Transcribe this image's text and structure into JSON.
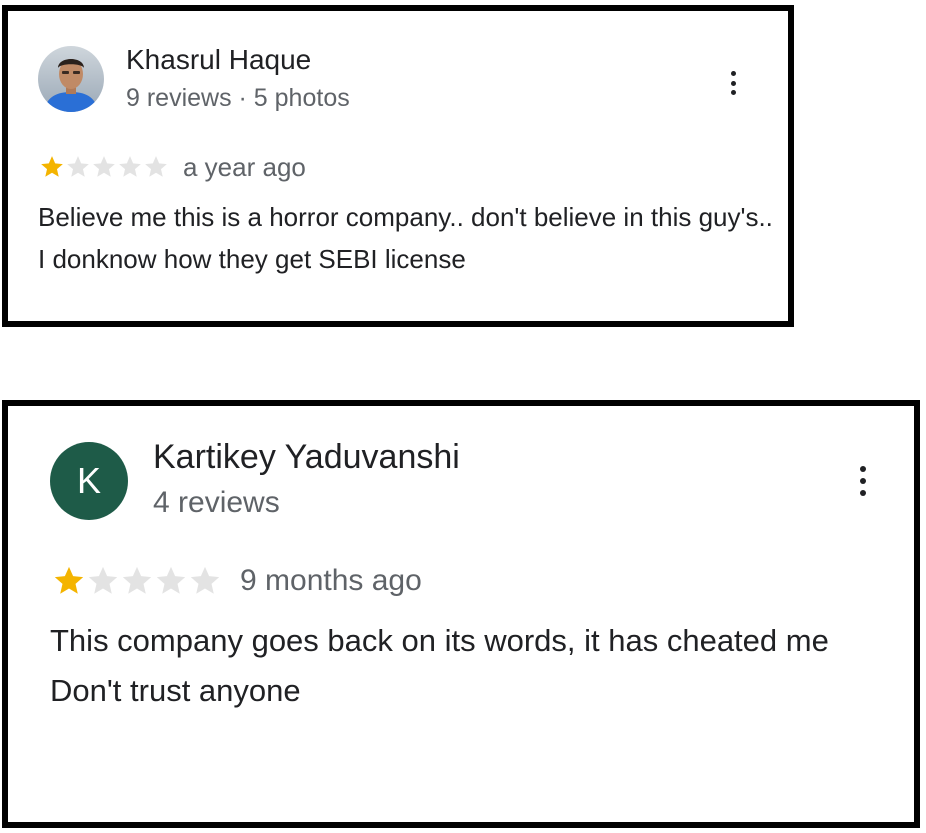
{
  "reviews": [
    {
      "reviewer_name": "Khasrul Haque",
      "meta": "9 reviews · 5 photos",
      "rating": 1,
      "rating_max": 5,
      "time": "a year ago",
      "text": "Believe me this is a horror company.. don't believe in this guy's..  I donknow how they get SEBI license",
      "avatar": "profile-photo"
    },
    {
      "reviewer_name": "Kartikey Yaduvanshi",
      "meta": "4 reviews",
      "rating": 1,
      "rating_max": 5,
      "time": "9 months ago",
      "text": "This company goes back on its words, it has cheated me\nDon't trust anyone",
      "avatar_letter": "K",
      "avatar_color": "#1e5b48"
    }
  ],
  "colors": {
    "star_filled": "#f4b400",
    "star_empty": "#e3e3e3",
    "secondary_text": "#5f6368",
    "primary_text": "#202124",
    "border": "#000000"
  },
  "icons": {
    "more_menu": "more-vert-icon",
    "star": "star-icon"
  }
}
